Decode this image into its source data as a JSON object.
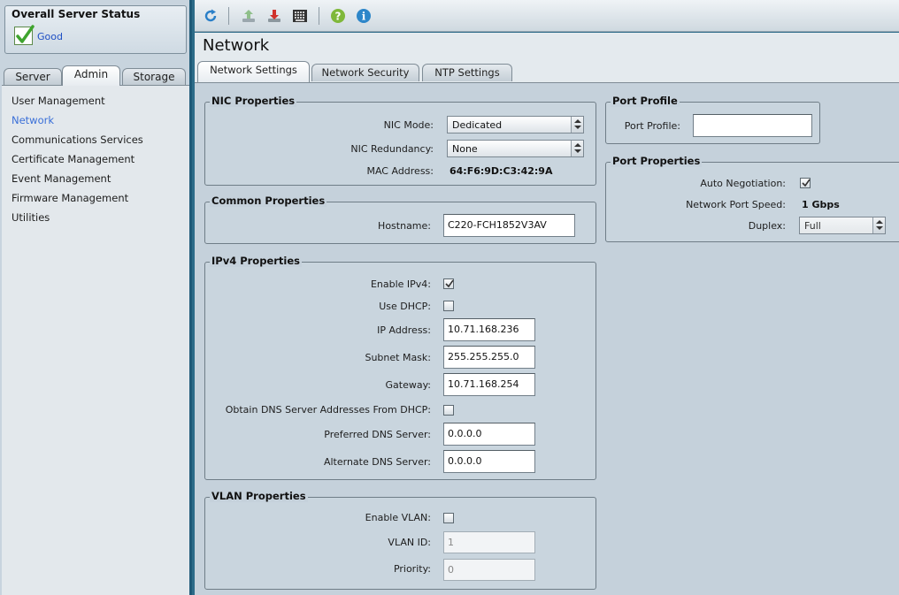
{
  "status": {
    "title": "Overall Server Status",
    "value": "Good"
  },
  "left_tabs": [
    "Server",
    "Admin",
    "Storage"
  ],
  "nav": [
    "User Management",
    "Network",
    "Communications Services",
    "Certificate Management",
    "Event Management",
    "Firmware Management",
    "Utilities"
  ],
  "page": {
    "title": "Network",
    "tabs": [
      "Network Settings",
      "Network Security",
      "NTP Settings"
    ]
  },
  "nic": {
    "title": "NIC Properties",
    "mode_label": "NIC Mode:",
    "mode_value": "Dedicated",
    "redundancy_label": "NIC Redundancy:",
    "redundancy_value": "None",
    "mac_label": "MAC Address:",
    "mac_value": "64:F6:9D:C3:42:9A"
  },
  "common": {
    "title": "Common Properties",
    "hostname_label": "Hostname:",
    "hostname_value": "C220-FCH1852V3AV"
  },
  "ipv4": {
    "title": "IPv4 Properties",
    "enable_label": "Enable IPv4:",
    "enable_checked": true,
    "dhcp_label": "Use DHCP:",
    "dhcp_checked": false,
    "ip_label": "IP Address:",
    "ip_value": "10.71.168.236",
    "mask_label": "Subnet Mask:",
    "mask_value": "255.255.255.0",
    "gateway_label": "Gateway:",
    "gateway_value": "10.71.168.254",
    "dns_dhcp_label": "Obtain DNS Server Addresses From DHCP:",
    "dns_dhcp_checked": false,
    "pref_dns_label": "Preferred DNS Server:",
    "pref_dns_value": "0.0.0.0",
    "alt_dns_label": "Alternate DNS Server:",
    "alt_dns_value": "0.0.0.0"
  },
  "vlan": {
    "title": "VLAN Properties",
    "enable_label": "Enable VLAN:",
    "enable_checked": false,
    "id_label": "VLAN ID:",
    "id_value": "1",
    "priority_label": "Priority:",
    "priority_value": "0"
  },
  "port_profile": {
    "title": "Port Profile",
    "label": "Port Profile:",
    "value": ""
  },
  "port_props": {
    "title": "Port Properties",
    "autoneg_label": "Auto Negotiation:",
    "autoneg_checked": true,
    "speed_label": "Network Port Speed:",
    "speed_value": "1 Gbps",
    "duplex_label": "Duplex:",
    "duplex_value": "Full"
  },
  "toolbar": {
    "icons": [
      "refresh-icon",
      "upload-icon",
      "download-icon",
      "keyboard-icon",
      "help-icon",
      "info-icon"
    ]
  },
  "colors": {
    "accent": "#2c6b88",
    "nav_active": "#3a6fd8",
    "status_good": "#1e4fc4"
  }
}
